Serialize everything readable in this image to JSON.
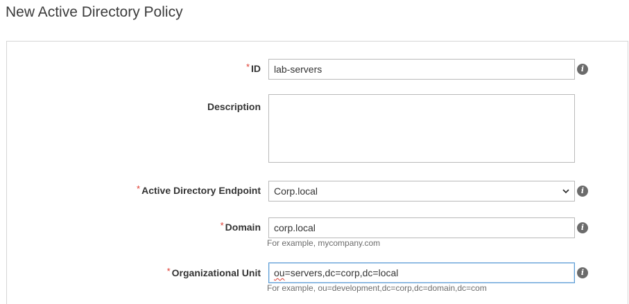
{
  "page": {
    "title": "New Active Directory Policy"
  },
  "form": {
    "required_marker": "*",
    "id": {
      "label": "ID",
      "value": "lab-servers",
      "required": true
    },
    "description": {
      "label": "Description",
      "value": "",
      "required": false
    },
    "endpoint": {
      "label": "Active Directory Endpoint",
      "selected": "Corp.local",
      "required": true
    },
    "domain": {
      "label": "Domain",
      "value": "corp.local",
      "hint": "For example, mycompany.com",
      "required": true
    },
    "ou": {
      "label": "Organizational Unit",
      "value_prefix": "ou",
      "value_rest": "=servers,dc=corp,dc=local",
      "hint": "For example, ou=development,dc=corp,dc=domain,dc=com",
      "required": true
    }
  },
  "icons": {
    "info": "info-icon",
    "dropdown": "chevron-down-icon"
  },
  "colors": {
    "required": "#e03a2f",
    "focus_border": "#5a9bd5",
    "info_icon": "#6b6b6b"
  }
}
